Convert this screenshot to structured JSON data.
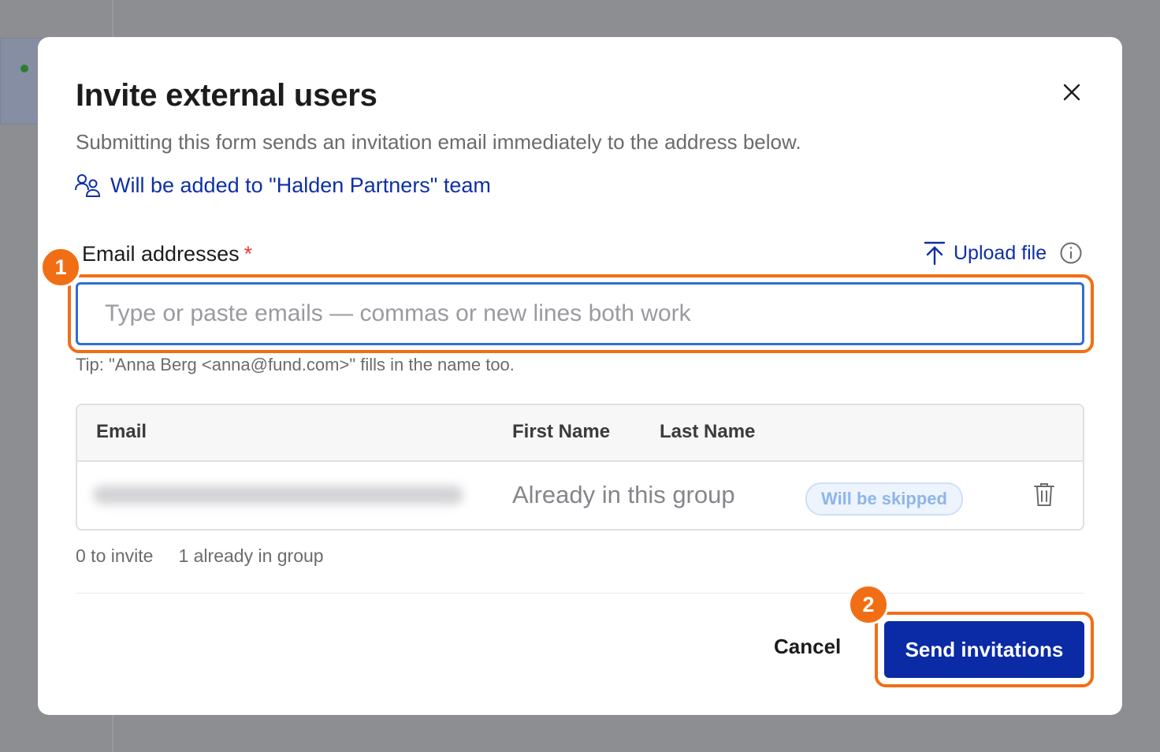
{
  "modal": {
    "title": "Invite external users",
    "subtitle": "Submitting this form sends an invitation email immediately to the address below.",
    "team_note": "Will be added to \"Halden Partners\" team"
  },
  "form": {
    "email_label": "Email addresses",
    "required_marker": "*",
    "upload_label": "Upload file",
    "input_placeholder": "Type or paste emails — commas or new lines both work",
    "tip": "Tip: \"Anna Berg <anna@fund.com>\" fills in the name too."
  },
  "table": {
    "headers": {
      "email": "Email",
      "first_name": "First Name",
      "last_name": "Last Name"
    },
    "rows": [
      {
        "status_text": "Already in this group",
        "badge": "Will be skipped"
      }
    ]
  },
  "summary": {
    "to_invite": "0 to invite",
    "already": "1 already in group"
  },
  "footer": {
    "cancel_label": "Cancel",
    "send_label": "Send invitations"
  },
  "annotations": {
    "step1": "1",
    "step2": "2"
  },
  "icons": [
    "close-icon",
    "team-icon",
    "upload-icon",
    "info-icon",
    "trash-icon"
  ],
  "colors": {
    "accent": "#0a2aa6",
    "highlight": "#f26e15",
    "required": "#e53935",
    "link": "#0f2fa6"
  }
}
